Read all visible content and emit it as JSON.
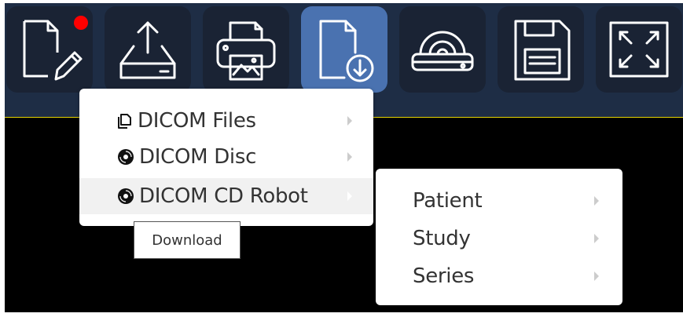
{
  "toolbar": {
    "buttons": [
      {
        "icon": "edit-document-icon",
        "notification": true
      },
      {
        "icon": "upload-tray-icon"
      },
      {
        "icon": "print-image-icon"
      },
      {
        "icon": "download-document-icon",
        "active": true
      },
      {
        "icon": "disc-drive-icon"
      },
      {
        "icon": "save-floppy-icon"
      },
      {
        "icon": "fullscreen-icon"
      }
    ],
    "active_color": "#4a72b0",
    "background_color": "#1e2d45",
    "notification_color": "#ff0000"
  },
  "menu": {
    "items": [
      {
        "label": "DICOM Files",
        "icon": "copy-files-icon",
        "has_submenu": true
      },
      {
        "label": "DICOM Disc",
        "icon": "disc-icon",
        "has_submenu": true
      },
      {
        "label": "DICOM CD Robot",
        "icon": "disc-icon",
        "has_submenu": true,
        "highlighted": true
      }
    ]
  },
  "submenu": {
    "items": [
      {
        "label": "Patient",
        "has_submenu": true
      },
      {
        "label": "Study",
        "has_submenu": true
      },
      {
        "label": "Series",
        "has_submenu": true
      }
    ]
  },
  "tooltip": {
    "text": "Download"
  }
}
